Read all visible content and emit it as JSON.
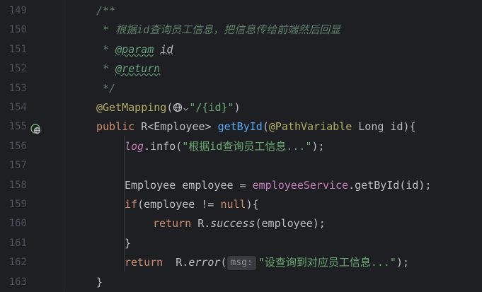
{
  "editor": {
    "lines": [
      {
        "n": "149",
        "parts": [
          [
            "doc",
            "/**"
          ]
        ]
      },
      {
        "n": "150",
        "parts": [
          [
            "doc",
            " * 根据id查询员工信息，把信息传给前端然后回显"
          ]
        ]
      },
      {
        "n": "151",
        "parts": [
          [
            "doc",
            " * "
          ],
          [
            "doctag",
            "@param"
          ],
          [
            "doc",
            " "
          ],
          [
            "docparam",
            "id"
          ]
        ]
      },
      {
        "n": "152",
        "parts": [
          [
            "doc",
            " * "
          ],
          [
            "doctag",
            "@return"
          ]
        ]
      },
      {
        "n": "153",
        "parts": [
          [
            "doc",
            " */"
          ]
        ]
      },
      {
        "n": "154",
        "parts": [
          [
            "ann",
            "@GetMapping"
          ],
          [
            "plain",
            "("
          ],
          [
            "globe",
            ""
          ],
          [
            "str",
            "\"/{id}\""
          ],
          [
            "plain",
            ")"
          ]
        ]
      },
      {
        "n": "155",
        "icon": "globe-endpoint-icon",
        "parts": [
          [
            "kw",
            "public"
          ],
          [
            "plain",
            " R<Employee> "
          ],
          [
            "method",
            "getById"
          ],
          [
            "plain",
            "("
          ],
          [
            "ann",
            "@PathVariable"
          ],
          [
            "plain",
            " Long id){"
          ]
        ]
      },
      {
        "n": "156",
        "indent": 1,
        "parts": [
          [
            "logf",
            "log"
          ],
          [
            "plain",
            ".info("
          ],
          [
            "str",
            "\"根据id查询员工信息...\""
          ],
          [
            "plain",
            ");"
          ]
        ]
      },
      {
        "n": "157",
        "indent": 1,
        "parts": []
      },
      {
        "n": "158",
        "indent": 1,
        "parts": [
          [
            "plain",
            "Employee employee = "
          ],
          [
            "field",
            "employeeService"
          ],
          [
            "plain",
            ".getById(id);"
          ]
        ]
      },
      {
        "n": "159",
        "indent": 1,
        "parts": [
          [
            "kw",
            "if"
          ],
          [
            "plain",
            "(employee != "
          ],
          [
            "kw",
            "null"
          ],
          [
            "plain",
            "){"
          ]
        ]
      },
      {
        "n": "160",
        "indent": 2,
        "parts": [
          [
            "kw",
            "return"
          ],
          [
            "plain",
            " R."
          ],
          [
            "italic",
            "success"
          ],
          [
            "plain",
            "(employee);"
          ]
        ]
      },
      {
        "n": "161",
        "indent": 1,
        "parts": [
          [
            "plain",
            "}"
          ]
        ]
      },
      {
        "n": "162",
        "indent": 1,
        "parts": [
          [
            "kw",
            "return"
          ],
          [
            "plain",
            "  R."
          ],
          [
            "italic",
            "error"
          ],
          [
            "plain",
            "("
          ],
          [
            "hint",
            "msg:"
          ],
          [
            "str",
            "\"设查询到对应员工信息...\""
          ],
          [
            "plain",
            ");"
          ]
        ]
      },
      {
        "n": "163",
        "indent": 0,
        "parts": [
          [
            "plain",
            "}"
          ]
        ]
      }
    ]
  }
}
